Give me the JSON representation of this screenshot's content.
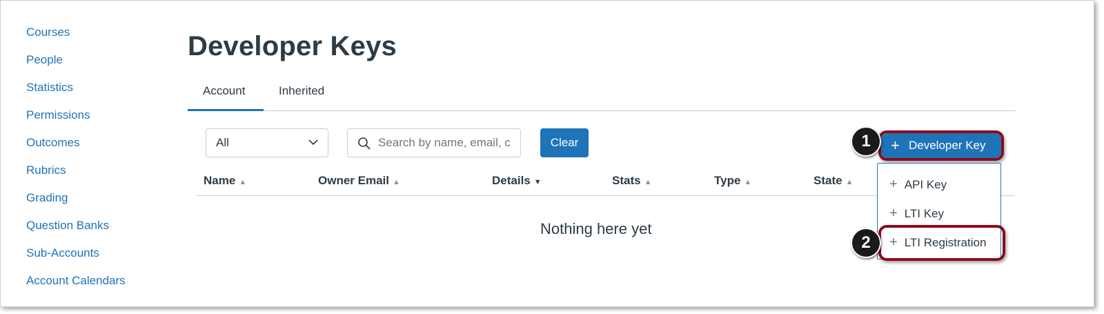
{
  "sidebar": {
    "items": [
      {
        "label": "Courses"
      },
      {
        "label": "People"
      },
      {
        "label": "Statistics"
      },
      {
        "label": "Permissions"
      },
      {
        "label": "Outcomes"
      },
      {
        "label": "Rubrics"
      },
      {
        "label": "Grading"
      },
      {
        "label": "Question Banks"
      },
      {
        "label": "Sub-Accounts"
      },
      {
        "label": "Account Calendars"
      }
    ]
  },
  "page": {
    "title": "Developer Keys"
  },
  "tabs": [
    {
      "label": "Account",
      "active": true
    },
    {
      "label": "Inherited",
      "active": false
    }
  ],
  "filters": {
    "type_select_value": "All",
    "search_placeholder": "Search by name, email, c",
    "clear_label": "Clear"
  },
  "table": {
    "columns": [
      {
        "label": "Name",
        "sort": "sortable"
      },
      {
        "label": "Owner Email",
        "sort": "sortable"
      },
      {
        "label": "Details",
        "sort": "descending"
      },
      {
        "label": "Stats",
        "sort": "sortable"
      },
      {
        "label": "Type",
        "sort": "sortable"
      },
      {
        "label": "State",
        "sort": "sortable"
      }
    ],
    "empty_message": "Nothing here yet"
  },
  "developer_key_button": {
    "label": "Developer Key"
  },
  "developer_key_menu": {
    "items": [
      {
        "label": "API Key"
      },
      {
        "label": "LTI Key"
      },
      {
        "label": "LTI Registration"
      }
    ]
  },
  "annotations": {
    "step_1": "1",
    "step_2": "2",
    "highlight_color": "#8e0a1a"
  },
  "colors": {
    "accent": "#1f73b7",
    "text": "#2d3b45"
  }
}
